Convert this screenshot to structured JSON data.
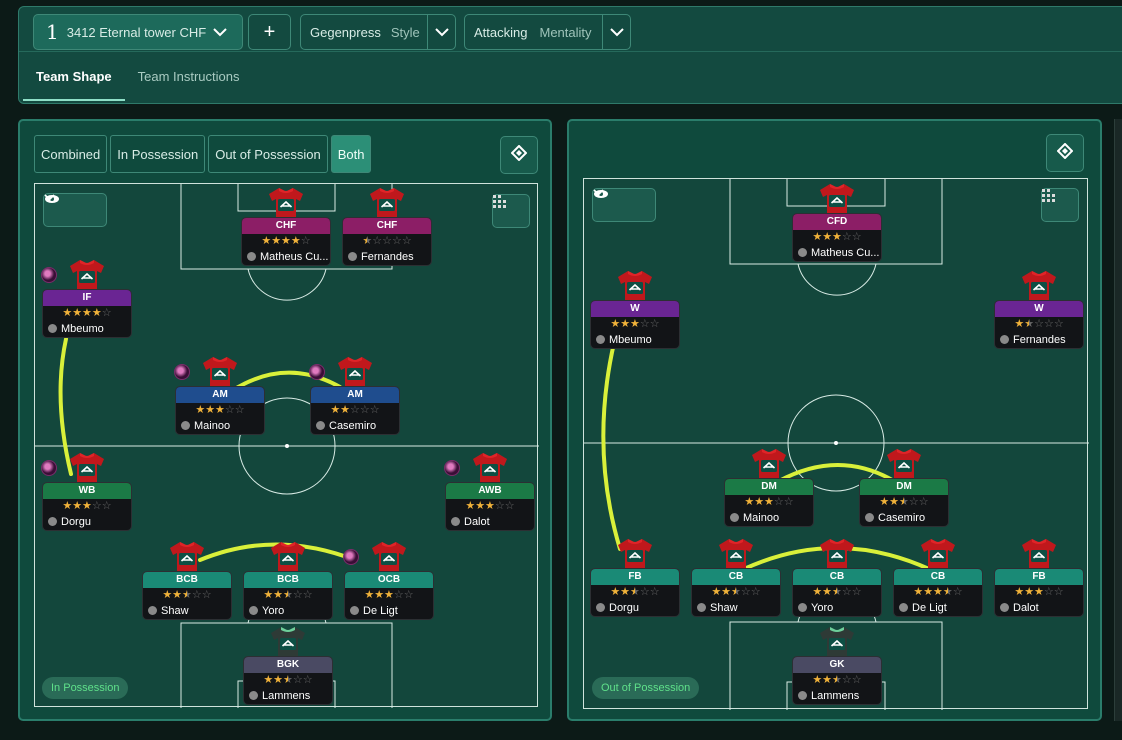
{
  "topbar": {
    "tactic_number": "1",
    "tactic_name": "3412 Eternal tower CHF",
    "add_label": "+",
    "style_value": "Gegenpress",
    "style_label": "Style",
    "mentality_value": "Attacking",
    "mentality_label": "Mentality",
    "tabs": [
      {
        "label": "Team Shape",
        "active": true
      },
      {
        "label": "Team Instructions",
        "active": false
      }
    ]
  },
  "left_panel": {
    "modes": [
      {
        "label": "Combined",
        "active": false
      },
      {
        "label": "In Possession",
        "active": false
      },
      {
        "label": "Out of Possession",
        "active": false
      },
      {
        "label": "Both",
        "active": true
      }
    ],
    "phase_badge": "In Possession",
    "players": [
      {
        "role": "CHF",
        "name": "Matheus Cu...",
        "stars": 4,
        "role_color": "#8c1e66"
      },
      {
        "role": "CHF",
        "name": "Fernandes",
        "stars": 0.5,
        "role_color": "#8c1e66"
      },
      {
        "role": "IF",
        "name": "Mbeumo",
        "stars": 4,
        "role_color": "#6a2593"
      },
      {
        "role": "AM",
        "name": "Mainoo",
        "stars": 3,
        "role_color": "#1f4d8e"
      },
      {
        "role": "AM",
        "name": "Casemiro",
        "stars": 2,
        "role_color": "#1f4d8e"
      },
      {
        "role": "WB",
        "name": "Dorgu",
        "stars": 3,
        "role_color": "#1b7a46"
      },
      {
        "role": "AWB",
        "name": "Dalot",
        "stars": 3,
        "role_color": "#1b7a46"
      },
      {
        "role": "BCB",
        "name": "Shaw",
        "stars": 2.5,
        "role_color": "#1a8a76"
      },
      {
        "role": "BCB",
        "name": "Yoro",
        "stars": 2.5,
        "role_color": "#1a8a76"
      },
      {
        "role": "OCB",
        "name": "De Ligt",
        "stars": 3,
        "role_color": "#1a8a76"
      },
      {
        "role": "BGK",
        "name": "Lammens",
        "stars": 2.5,
        "role_color": "#4a4a63"
      }
    ]
  },
  "right_panel": {
    "phase_badge": "Out of Possession",
    "players": [
      {
        "role": "CFD",
        "name": "Matheus Cu...",
        "stars": 3,
        "role_color": "#8c1e66"
      },
      {
        "role": "W",
        "name": "Mbeumo",
        "stars": 3,
        "role_color": "#6a2593"
      },
      {
        "role": "W",
        "name": "Fernandes",
        "stars": 1.5,
        "role_color": "#6a2593"
      },
      {
        "role": "DM",
        "name": "Mainoo",
        "stars": 3,
        "role_color": "#1b7a46"
      },
      {
        "role": "DM",
        "name": "Casemiro",
        "stars": 2.5,
        "role_color": "#1b7a46"
      },
      {
        "role": "FB",
        "name": "Dorgu",
        "stars": 2.5,
        "role_color": "#1a8a76"
      },
      {
        "role": "CB",
        "name": "Shaw",
        "stars": 2.5,
        "role_color": "#1a8a76"
      },
      {
        "role": "CB",
        "name": "Yoro",
        "stars": 2.5,
        "role_color": "#1a8a76"
      },
      {
        "role": "CB",
        "name": "De Ligt",
        "stars": 3.5,
        "role_color": "#1a8a76"
      },
      {
        "role": "FB",
        "name": "Dalot",
        "stars": 3,
        "role_color": "#1a8a76"
      },
      {
        "role": "GK",
        "name": "Lammens",
        "stars": 2.5,
        "role_color": "#4a4a63"
      }
    ]
  },
  "icons": {
    "tactic_dropdown": "chevron-down-icon",
    "view_toggle": "eye-icon",
    "grid": "grid-icon",
    "swap": "swap-icon"
  }
}
